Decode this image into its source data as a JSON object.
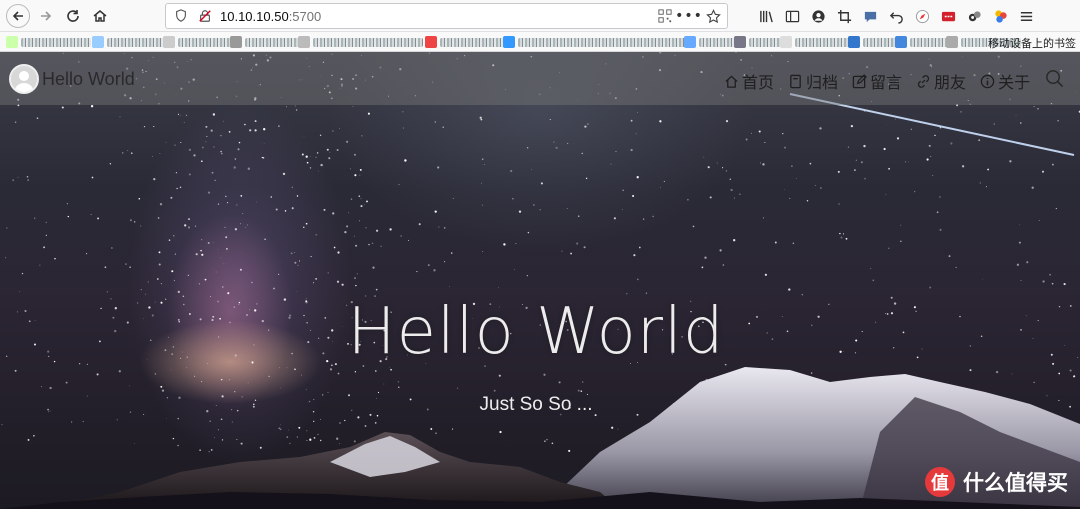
{
  "browser": {
    "url_host": "10.10.10.50",
    "url_port": ":5700",
    "bookmarks_overflow_label": "移动设备上的书签"
  },
  "site": {
    "name": "Hello World",
    "nav": [
      {
        "icon": "home-icon",
        "label": "首页"
      },
      {
        "icon": "archive-icon",
        "label": "归档"
      },
      {
        "icon": "edit-icon",
        "label": "留言"
      },
      {
        "icon": "link-icon",
        "label": "朋友"
      },
      {
        "icon": "info-icon",
        "label": "关于"
      }
    ]
  },
  "hero": {
    "title": "Hello World",
    "subtitle": "Just So So ..."
  },
  "watermark": {
    "icon_text": "值",
    "text": "什么值得买"
  },
  "colors": {
    "nav_bg": "rgba(120,120,120,0.45)",
    "watermark_red": "#e6393c"
  }
}
